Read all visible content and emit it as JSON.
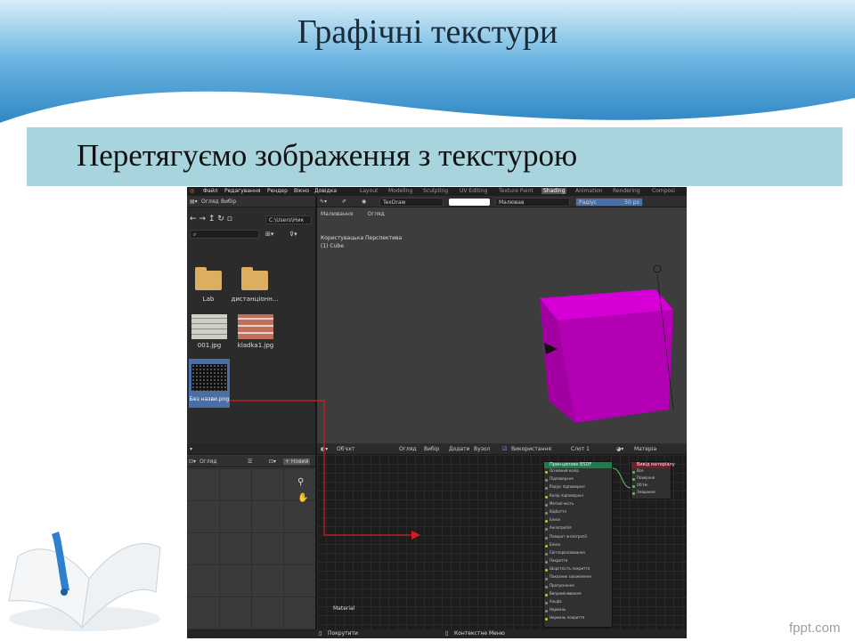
{
  "slide": {
    "title": "Графічні текстури",
    "subtitle": "Перетягуємо зображення з текстурою",
    "watermark": "fppt.com"
  },
  "blender": {
    "menu": [
      "Файл",
      "Редагування",
      "Рендер",
      "Вікно",
      "Довідка"
    ],
    "workspaces": [
      "Layout",
      "Modeling",
      "Sculpting",
      "UV Editing",
      "Texture Paint",
      "Shading",
      "Animation",
      "Rendering",
      "Composi"
    ],
    "active_workspace": "Shading",
    "browser": {
      "view_label": "Огляд",
      "select_label": "Вибір",
      "path": "C:\\Users\\Ник",
      "files": [
        {
          "name": "Lab",
          "kind": "folder"
        },
        {
          "name": "дистанціонн...",
          "kind": "folder"
        },
        {
          "name": "001.jpg",
          "kind": "image"
        },
        {
          "name": "kladka1.jpg",
          "kind": "image"
        },
        {
          "name": "Без назви.png",
          "kind": "image"
        }
      ]
    },
    "viewport": {
      "brush": "TexDraw",
      "mode_label": "Малювання",
      "view_label": "Огляд",
      "radius_label": "Радіус",
      "radius_value": "50 px",
      "mapping": "Малював",
      "overlay_text": "Користувацька Перспектива",
      "object_label": "(1) Cube",
      "cube_color": "#b400b4"
    },
    "image_editor": {
      "view_label": "Огляд",
      "new_label": "+ Новий"
    },
    "node_editor": {
      "object_label": "Об'єкт",
      "menus": [
        "Огляд",
        "Вибір",
        "Додати",
        "Вузол"
      ],
      "use_nodes": "Використання",
      "slot": "Слот 1",
      "material": "Матеріа",
      "footer_label": "Material",
      "bsdf_title": "Принципове BSDF",
      "bsdf_rows": [
        "Основний колір",
        "Підповерхня",
        "Радіус підповерхні",
        "Колір підповерхні",
        "Металічність",
        "Відбиття",
        "Блиск",
        "Анізотропія",
        "Поворот анізотропії",
        "Блиск",
        "Світлорозсіювання",
        "Покриття",
        "Шорсткість покриття",
        "Показник заломлення",
        "Пропускання",
        "Випромінювання",
        "Альфа",
        "Нормаль",
        "Нормаль покриття"
      ],
      "output_title": "Вивід матеріалу",
      "output_rows": [
        "Все",
        "Поверхня",
        "Об'єм",
        "Зміщення"
      ]
    },
    "status": [
      "Покрутити",
      "Контекстне Меню"
    ]
  },
  "accent_colors": {
    "cube": "#b400b4",
    "bsdf_header": "#1c7f4b",
    "output_header": "#7a1a28",
    "arrow": "#d81c1c",
    "slide_header": "#3a8fc9",
    "subtitle_band": "#a8d4dd"
  }
}
